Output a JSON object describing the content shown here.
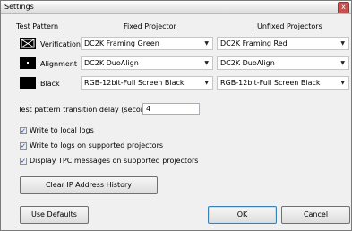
{
  "window": {
    "title": "Settings",
    "close_glyph": "x"
  },
  "headers": {
    "test_pattern": "Test Pattern",
    "fixed_projector": "Fixed Projector",
    "unfixed_projectors": "Unfixed Projectors"
  },
  "rows": [
    {
      "icon": "framing-pattern-icon",
      "label": "Verification",
      "fixed": "DC2K Framing Green",
      "unfixed": "DC2K Framing Red"
    },
    {
      "icon": "alignment-pattern-icon",
      "label": "Alignment",
      "fixed": "DC2K DuoAlign",
      "unfixed": "DC2K DuoAlign"
    },
    {
      "icon": "black-pattern-icon",
      "label": "Black",
      "fixed": "RGB-12bit-Full Screen Black",
      "unfixed": "RGB-12bit-Full Screen Black"
    }
  ],
  "transition_delay": {
    "label": "Test pattern transition delay (seconds):",
    "value": "4"
  },
  "checkboxes": [
    {
      "label": "Write to local logs",
      "checked": true
    },
    {
      "label": "Write to logs on supported projectors",
      "checked": true
    },
    {
      "label": "Display TPC messages on supported projectors",
      "checked": true
    }
  ],
  "buttons": {
    "clear_ip": "Clear IP Address History",
    "use_defaults_prefix": "Use ",
    "use_defaults_mnemonic": "D",
    "use_defaults_suffix": "efaults",
    "ok_mnemonic": "O",
    "ok_suffix": "K",
    "cancel": "Cancel"
  },
  "dropdown_glyph": "▼",
  "check_glyph": "✓"
}
